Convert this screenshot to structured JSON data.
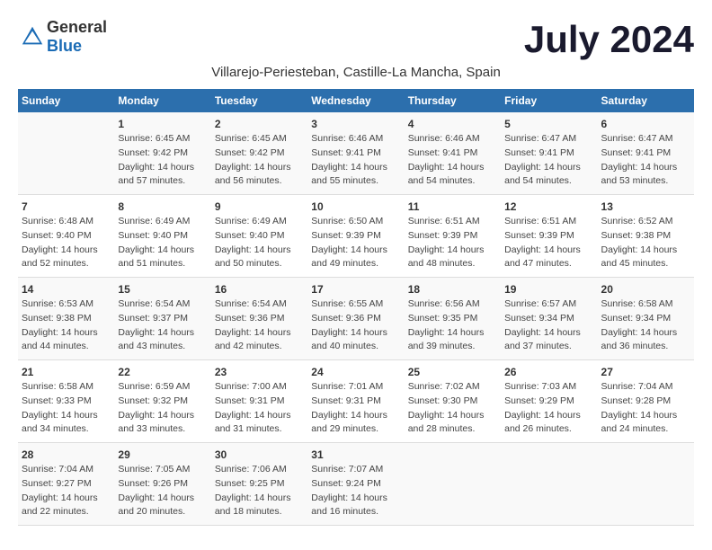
{
  "header": {
    "logo_general": "General",
    "logo_blue": "Blue",
    "title": "July 2024",
    "subtitle": "Villarejo-Periesteban, Castille-La Mancha, Spain"
  },
  "columns": [
    "Sunday",
    "Monday",
    "Tuesday",
    "Wednesday",
    "Thursday",
    "Friday",
    "Saturday"
  ],
  "weeks": [
    {
      "days": [
        {
          "num": "",
          "info": ""
        },
        {
          "num": "1",
          "info": "Sunrise: 6:45 AM\nSunset: 9:42 PM\nDaylight: 14 hours\nand 57 minutes."
        },
        {
          "num": "2",
          "info": "Sunrise: 6:45 AM\nSunset: 9:42 PM\nDaylight: 14 hours\nand 56 minutes."
        },
        {
          "num": "3",
          "info": "Sunrise: 6:46 AM\nSunset: 9:41 PM\nDaylight: 14 hours\nand 55 minutes."
        },
        {
          "num": "4",
          "info": "Sunrise: 6:46 AM\nSunset: 9:41 PM\nDaylight: 14 hours\nand 54 minutes."
        },
        {
          "num": "5",
          "info": "Sunrise: 6:47 AM\nSunset: 9:41 PM\nDaylight: 14 hours\nand 54 minutes."
        },
        {
          "num": "6",
          "info": "Sunrise: 6:47 AM\nSunset: 9:41 PM\nDaylight: 14 hours\nand 53 minutes."
        }
      ]
    },
    {
      "days": [
        {
          "num": "7",
          "info": "Sunrise: 6:48 AM\nSunset: 9:40 PM\nDaylight: 14 hours\nand 52 minutes."
        },
        {
          "num": "8",
          "info": "Sunrise: 6:49 AM\nSunset: 9:40 PM\nDaylight: 14 hours\nand 51 minutes."
        },
        {
          "num": "9",
          "info": "Sunrise: 6:49 AM\nSunset: 9:40 PM\nDaylight: 14 hours\nand 50 minutes."
        },
        {
          "num": "10",
          "info": "Sunrise: 6:50 AM\nSunset: 9:39 PM\nDaylight: 14 hours\nand 49 minutes."
        },
        {
          "num": "11",
          "info": "Sunrise: 6:51 AM\nSunset: 9:39 PM\nDaylight: 14 hours\nand 48 minutes."
        },
        {
          "num": "12",
          "info": "Sunrise: 6:51 AM\nSunset: 9:39 PM\nDaylight: 14 hours\nand 47 minutes."
        },
        {
          "num": "13",
          "info": "Sunrise: 6:52 AM\nSunset: 9:38 PM\nDaylight: 14 hours\nand 45 minutes."
        }
      ]
    },
    {
      "days": [
        {
          "num": "14",
          "info": "Sunrise: 6:53 AM\nSunset: 9:38 PM\nDaylight: 14 hours\nand 44 minutes."
        },
        {
          "num": "15",
          "info": "Sunrise: 6:54 AM\nSunset: 9:37 PM\nDaylight: 14 hours\nand 43 minutes."
        },
        {
          "num": "16",
          "info": "Sunrise: 6:54 AM\nSunset: 9:36 PM\nDaylight: 14 hours\nand 42 minutes."
        },
        {
          "num": "17",
          "info": "Sunrise: 6:55 AM\nSunset: 9:36 PM\nDaylight: 14 hours\nand 40 minutes."
        },
        {
          "num": "18",
          "info": "Sunrise: 6:56 AM\nSunset: 9:35 PM\nDaylight: 14 hours\nand 39 minutes."
        },
        {
          "num": "19",
          "info": "Sunrise: 6:57 AM\nSunset: 9:34 PM\nDaylight: 14 hours\nand 37 minutes."
        },
        {
          "num": "20",
          "info": "Sunrise: 6:58 AM\nSunset: 9:34 PM\nDaylight: 14 hours\nand 36 minutes."
        }
      ]
    },
    {
      "days": [
        {
          "num": "21",
          "info": "Sunrise: 6:58 AM\nSunset: 9:33 PM\nDaylight: 14 hours\nand 34 minutes."
        },
        {
          "num": "22",
          "info": "Sunrise: 6:59 AM\nSunset: 9:32 PM\nDaylight: 14 hours\nand 33 minutes."
        },
        {
          "num": "23",
          "info": "Sunrise: 7:00 AM\nSunset: 9:31 PM\nDaylight: 14 hours\nand 31 minutes."
        },
        {
          "num": "24",
          "info": "Sunrise: 7:01 AM\nSunset: 9:31 PM\nDaylight: 14 hours\nand 29 minutes."
        },
        {
          "num": "25",
          "info": "Sunrise: 7:02 AM\nSunset: 9:30 PM\nDaylight: 14 hours\nand 28 minutes."
        },
        {
          "num": "26",
          "info": "Sunrise: 7:03 AM\nSunset: 9:29 PM\nDaylight: 14 hours\nand 26 minutes."
        },
        {
          "num": "27",
          "info": "Sunrise: 7:04 AM\nSunset: 9:28 PM\nDaylight: 14 hours\nand 24 minutes."
        }
      ]
    },
    {
      "days": [
        {
          "num": "28",
          "info": "Sunrise: 7:04 AM\nSunset: 9:27 PM\nDaylight: 14 hours\nand 22 minutes."
        },
        {
          "num": "29",
          "info": "Sunrise: 7:05 AM\nSunset: 9:26 PM\nDaylight: 14 hours\nand 20 minutes."
        },
        {
          "num": "30",
          "info": "Sunrise: 7:06 AM\nSunset: 9:25 PM\nDaylight: 14 hours\nand 18 minutes."
        },
        {
          "num": "31",
          "info": "Sunrise: 7:07 AM\nSunset: 9:24 PM\nDaylight: 14 hours\nand 16 minutes."
        },
        {
          "num": "",
          "info": ""
        },
        {
          "num": "",
          "info": ""
        },
        {
          "num": "",
          "info": ""
        }
      ]
    }
  ]
}
